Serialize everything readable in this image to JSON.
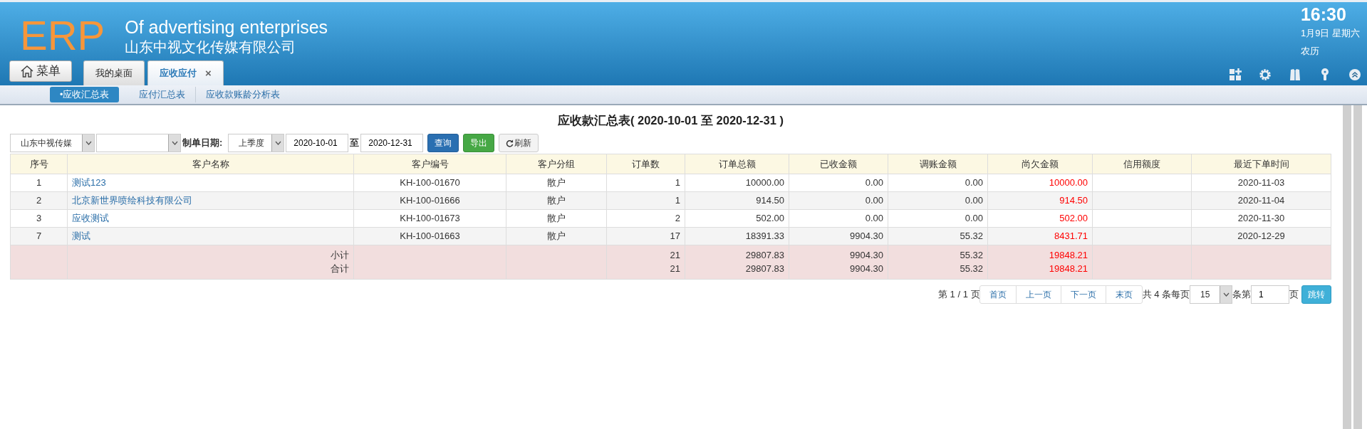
{
  "header": {
    "logo": "ERP",
    "title": "Of advertising enterprises",
    "company": "山东中视文化传媒有限公司",
    "clock": {
      "time": "16:30",
      "date": "1月9日 星期六",
      "lunar": "农历"
    }
  },
  "menu_button": {
    "label": "菜单"
  },
  "tabs": [
    {
      "label": "我的桌面",
      "selected": false
    },
    {
      "label": "应收应付",
      "selected": true,
      "close": "×"
    }
  ],
  "subnav": [
    {
      "label": "•应收汇总表",
      "selected": true
    },
    {
      "label": "应付汇总表",
      "selected": false
    },
    {
      "label": "应收款账龄分析表",
      "selected": false
    }
  ],
  "report_title": "应收款汇总表( 2020-10-01 至 2020-12-31 )",
  "filters": {
    "company": "山东中视传媒",
    "date_label": "制单日期:",
    "period": "上季度",
    "date_from": "2020-10-01",
    "to_label": "至",
    "date_to": "2020-12-31",
    "buttons": [
      {
        "label": "查询",
        "kind": "primary"
      },
      {
        "label": "导出",
        "kind": "success"
      },
      {
        "label": "刷新",
        "kind": "refresh"
      }
    ]
  },
  "table": {
    "columns": [
      "序号",
      "客户名称",
      "客户编号",
      "客户分组",
      "订单数",
      "订单总额",
      "已收金额",
      "调账金额",
      "尚欠金额",
      "信用额度",
      "最近下单时间"
    ],
    "rows": [
      [
        "1",
        "测试123",
        "KH-100-01670",
        "散户",
        "1",
        "10000.00",
        "0.00",
        "0.00",
        "10000.00",
        "",
        "2020-11-03"
      ],
      [
        "2",
        "北京新世界喷绘科技有限公司",
        "KH-100-01666",
        "散户",
        "1",
        "914.50",
        "0.00",
        "0.00",
        "914.50",
        "",
        "2020-11-04"
      ],
      [
        "3",
        "应收测试",
        "KH-100-01673",
        "散户",
        "2",
        "502.00",
        "0.00",
        "0.00",
        "502.00",
        "",
        "2020-11-30"
      ],
      [
        "7",
        "测试",
        "KH-100-01663",
        "散户",
        "17",
        "18391.33",
        "9904.30",
        "55.32",
        "8431.71",
        "",
        "2020-12-29"
      ]
    ],
    "totals": [
      {
        "label": "小计",
        "orders": "21",
        "total": "29807.83",
        "received": "9904.30",
        "adjust": "55.32",
        "owed": "19848.21"
      },
      {
        "label": "合计",
        "orders": "21",
        "total": "29807.83",
        "received": "9904.30",
        "adjust": "55.32",
        "owed": "19848.21"
      }
    ]
  },
  "pager": {
    "page_info": "第 1 / 1 页",
    "buttons": [
      "首页",
      "上一页",
      "下一页",
      "末页"
    ],
    "count_text": "共 4 条每页",
    "page_size": "15",
    "goto_prefix": "条第",
    "goto_value": "1",
    "goto_suffix": "页",
    "goto_button": "跳转"
  }
}
